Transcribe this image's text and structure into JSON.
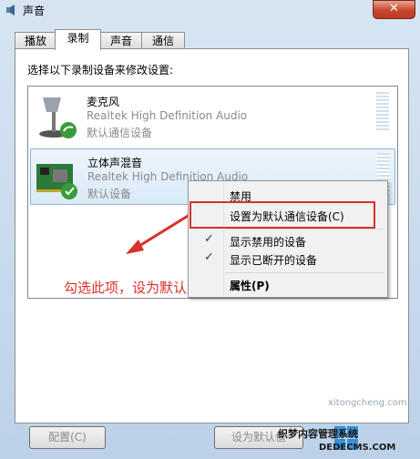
{
  "window": {
    "title": "声音",
    "close_label": "✕"
  },
  "tabs": [
    {
      "label": "播放"
    },
    {
      "label": "录制"
    },
    {
      "label": "声音"
    },
    {
      "label": "通信"
    }
  ],
  "instruction": "选择以下录制设备来修改设置:",
  "devices": [
    {
      "name": "麦克风",
      "driver": "Realtek High Definition Audio",
      "status": "默认通信设备"
    },
    {
      "name": "立体声混音",
      "driver": "Realtek High Definition Audio",
      "status": "默认设备"
    }
  ],
  "context_menu": {
    "items": [
      {
        "label": "禁用",
        "checked": false
      },
      {
        "label": "设置为默认通信设备(C)",
        "checked": false
      },
      {
        "label": "显示禁用的设备",
        "checked": true
      },
      {
        "label": "显示已断开的设备",
        "checked": true
      },
      {
        "label": "属性(P)",
        "checked": false
      }
    ]
  },
  "annotation": "勾选此项，设为默认设备",
  "buttons": {
    "configure": "配置(C)",
    "set_default": "设为默认值"
  },
  "watermark": {
    "url": "xitongcheng.com",
    "brand": "织梦内容管理系统",
    "brand_url": "DEDECMS.COM"
  },
  "colors": {
    "accent": "#d9302a",
    "selection": "#d9eaf8"
  }
}
